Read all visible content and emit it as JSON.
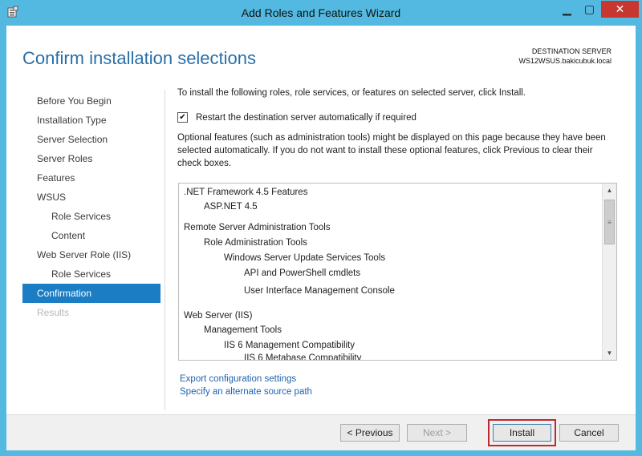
{
  "window": {
    "title": "Add Roles and Features Wizard",
    "controls": {
      "minimize": "▁",
      "maximize": "▢",
      "close": "✕"
    }
  },
  "header": {
    "page_title": "Confirm installation selections",
    "destination_label": "DESTINATION SERVER",
    "destination_server": "WS12WSUS.bakicubuk.local"
  },
  "nav": {
    "items": [
      {
        "label": "Before You Begin",
        "state": "normal",
        "level": 0
      },
      {
        "label": "Installation Type",
        "state": "normal",
        "level": 0
      },
      {
        "label": "Server Selection",
        "state": "normal",
        "level": 0
      },
      {
        "label": "Server Roles",
        "state": "normal",
        "level": 0
      },
      {
        "label": "Features",
        "state": "normal",
        "level": 0
      },
      {
        "label": "WSUS",
        "state": "normal",
        "level": 0
      },
      {
        "label": "Role Services",
        "state": "normal",
        "level": 1
      },
      {
        "label": "Content",
        "state": "normal",
        "level": 1
      },
      {
        "label": "Web Server Role (IIS)",
        "state": "normal",
        "level": 0
      },
      {
        "label": "Role Services",
        "state": "normal",
        "level": 1
      },
      {
        "label": "Confirmation",
        "state": "active",
        "level": 0
      },
      {
        "label": "Results",
        "state": "disabled",
        "level": 0
      }
    ]
  },
  "main": {
    "intro": "To install the following roles, role services, or features on selected server, click Install.",
    "restart_checkbox": {
      "label": "Restart the destination server automatically if required",
      "checked": true,
      "mark": "✔"
    },
    "optional_note": "Optional features (such as administration tools) might be displayed on this page because they have been selected automatically. If you do not want to install these optional features, click Previous to clear their check boxes.",
    "selections": [
      {
        "text": ".NET Framework 4.5 Features",
        "indent": 0
      },
      {
        "text": "ASP.NET 4.5",
        "indent": 1
      },
      {
        "text": "Remote Server Administration Tools",
        "indent": 0
      },
      {
        "text": "Role Administration Tools",
        "indent": 1
      },
      {
        "text": "Windows Server Update Services Tools",
        "indent": 2
      },
      {
        "text": "API and PowerShell cmdlets",
        "indent": 3
      },
      {
        "text": "User Interface Management Console",
        "indent": 3
      },
      {
        "text": "Web Server (IIS)",
        "indent": 0
      },
      {
        "text": "Management Tools",
        "indent": 1
      },
      {
        "text": "IIS 6 Management Compatibility",
        "indent": 2
      },
      {
        "text": "IIS 6 Metabase Compatibility",
        "indent": 3
      }
    ],
    "scroll": {
      "up": "▲",
      "down": "▼",
      "grip": "≡"
    },
    "export_link": "Export configuration settings",
    "alt_source_link": "Specify an alternate source path"
  },
  "footer": {
    "previous": "< Previous",
    "next": "Next >",
    "install": "Install",
    "cancel": "Cancel"
  }
}
